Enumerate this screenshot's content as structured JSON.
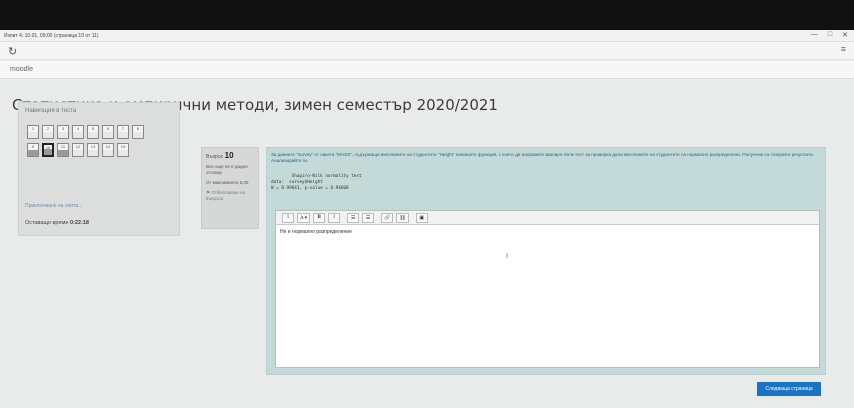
{
  "window": {
    "title": "Изпит 4, 10.01, 09:00 (страница 10 от 11)",
    "controls": [
      "—",
      "□",
      "✕"
    ],
    "menu_icon": "≡",
    "reload_icon": "reload-icon"
  },
  "moodle": {
    "brand": "moodle"
  },
  "course": {
    "title": "Статистика и емпирични методи, зимен семестър 2020/2021"
  },
  "quiz_nav": {
    "title": "Навигация в теста",
    "rows": [
      [
        "1",
        "2",
        "3",
        "4",
        "5",
        "6",
        "7",
        "8"
      ],
      [
        "9",
        "10",
        "11",
        "12",
        "13",
        "14",
        "15"
      ]
    ],
    "current": "10",
    "finish_link": "Приключване на опита...",
    "time_label": "Оставащо време",
    "time_value": "0:22:18"
  },
  "question": {
    "number_label": "Въпрос",
    "number": "10",
    "status": "Все още не е даден отговор",
    "marks": "От максимално 5,00",
    "flag": "Отбелязване на въпроса",
    "text": "За данните \"survey\" от пакета \"MASS\", съдържащи височините на студентите \"Height\" напишете функция, с която да направите Шапиро-Уилк тест за проверка дали височините на студентите са нормално разпределени. Получени са следните резултати. Анализирайте ги.",
    "code_lines": [
      "        Shapiro-Wilk normality test",
      "data:  survey$Height",
      "W = 0.99641, p-value = 0.94608"
    ],
    "editor": {
      "tools": [
        "1",
        "A ▾",
        "B",
        "I",
        "☰",
        "☰",
        "🔗",
        "⛓",
        "▣"
      ],
      "answer": "Не е нормално разпределение",
      "cursor": "I"
    }
  },
  "footer": {
    "next_button": "Следваща страница"
  }
}
